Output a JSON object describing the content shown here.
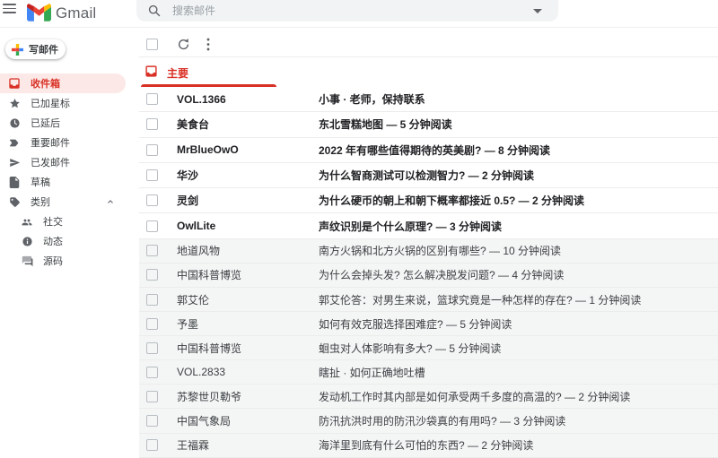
{
  "header": {
    "app_name": "Gmail",
    "search_placeholder": "搜索邮件"
  },
  "compose": {
    "label": "写邮件"
  },
  "sidebar": {
    "items": [
      {
        "label": "收件箱",
        "selected": true
      },
      {
        "label": "已加星标"
      },
      {
        "label": "已延后"
      },
      {
        "label": "重要邮件"
      },
      {
        "label": "已发邮件"
      },
      {
        "label": "草稿"
      },
      {
        "label": "类别",
        "collapsible": true
      },
      {
        "label": "社交",
        "indent": true
      },
      {
        "label": "动态",
        "indent": true
      },
      {
        "label": "源码",
        "indent": true
      }
    ]
  },
  "tabs": [
    {
      "label": "主要",
      "active": true
    }
  ],
  "emails": [
    {
      "sender": "VOL.1366",
      "subject": "小事 · 老师，保持联系",
      "unread": true
    },
    {
      "sender": "美食台",
      "subject": "东北雪糕地图 — 5 分钟阅读",
      "unread": true
    },
    {
      "sender": "MrBlueOwO",
      "subject": "2022 年有哪些值得期待的英美剧? — 8 分钟阅读",
      "unread": true
    },
    {
      "sender": "华沙",
      "subject": "为什么智商测试可以检测智力? — 2 分钟阅读",
      "unread": true
    },
    {
      "sender": "灵剑",
      "subject": "为什么硬币的朝上和朝下概率都接近 0.5? — 2 分钟阅读",
      "unread": true
    },
    {
      "sender": "OwlLite",
      "subject": "声纹识别是个什么原理? — 3 分钟阅读",
      "unread": true
    },
    {
      "sender": "地道风物",
      "subject": "南方火锅和北方火锅的区别有哪些? — 10 分钟阅读",
      "unread": false
    },
    {
      "sender": "中国科普博览",
      "subject": "为什么会掉头发? 怎么解决脱发问题? — 4 分钟阅读",
      "unread": false
    },
    {
      "sender": "郭艾伦",
      "subject": "郭艾伦答：对男生来说，篮球究竟是一种怎样的存在? — 1 分钟阅读",
      "unread": false
    },
    {
      "sender": "予墨",
      "subject": "如何有效克服选择困难症? — 5 分钟阅读",
      "unread": false
    },
    {
      "sender": "中国科普博览",
      "subject": "蛔虫对人体影响有多大? — 5 分钟阅读",
      "unread": false
    },
    {
      "sender": "VOL.2833",
      "subject": "瞎扯 · 如何正确地吐槽",
      "unread": false
    },
    {
      "sender": "苏黎世贝勒爷",
      "subject": "发动机工作时其内部是如何承受两千多度的高温的? — 2 分钟阅读",
      "unread": false
    },
    {
      "sender": "中国气象局",
      "subject": "防汛抗洪时用的防汛沙袋真的有用吗? — 3 分钟阅读",
      "unread": false
    },
    {
      "sender": "王福霖",
      "subject": "海洋里到底有什么可怕的东西? — 2 分钟阅读",
      "unread": false
    }
  ],
  "colors": {
    "accent_red": "#d93025",
    "selected_item_bg": "#fce8e6",
    "read_row_bg": "#f4f5f5",
    "search_bg": "#f1f3f4",
    "icon_grey": "#5f6368",
    "logo_blue": "#4285f4",
    "logo_red": "#ea4335",
    "logo_yellow": "#fbbc04",
    "logo_green": "#34a853"
  }
}
